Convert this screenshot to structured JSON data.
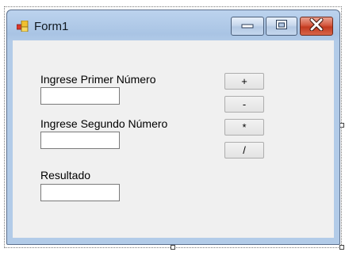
{
  "window": {
    "title": "Form1",
    "icon": "winforms-form-icon",
    "controls": {
      "minimize_icon": "minimize-icon",
      "maximize_icon": "maximize-icon",
      "close_icon": "close-icon"
    }
  },
  "form": {
    "label_first": "Ingrese Primer Número",
    "label_second": "Ingrese Segundo Número",
    "label_result": "Resultado",
    "input_first_value": "",
    "input_second_value": "",
    "input_result_value": ""
  },
  "buttons": {
    "add_label": "+",
    "subtract_label": "-",
    "multiply_label": "*",
    "divide_label": "/"
  },
  "colors": {
    "titlebar": "#a9c4e4",
    "client_background": "#f0f0f0",
    "close_button": "#c2391f"
  }
}
